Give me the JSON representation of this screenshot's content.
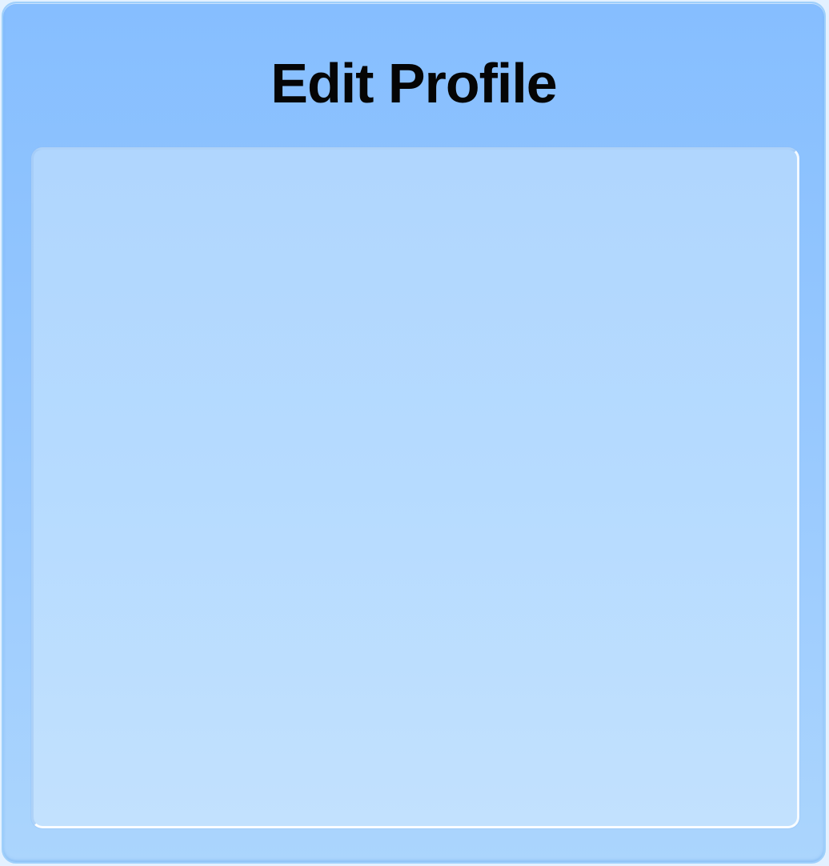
{
  "dialog": {
    "title": "Edit Profile"
  },
  "colors": {
    "window_top": "#86beff",
    "window_bottom": "#abd5fd",
    "panel": "#b6dbff",
    "title_text": "#050505"
  }
}
